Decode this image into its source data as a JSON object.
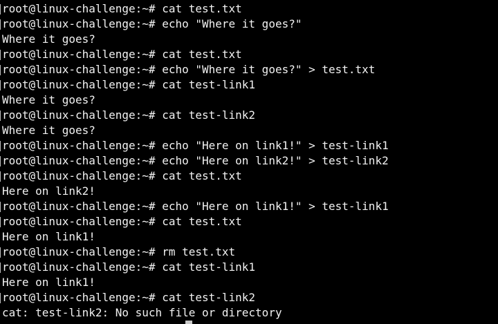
{
  "terminal": {
    "lines": [
      {
        "type": "prompt",
        "text": "root@linux-challenge:~# cat test.txt"
      },
      {
        "type": "prompt",
        "text": "root@linux-challenge:~# echo \"Where it goes?\""
      },
      {
        "type": "output",
        "text": "Where it goes?"
      },
      {
        "type": "prompt",
        "text": "root@linux-challenge:~# cat test.txt"
      },
      {
        "type": "prompt",
        "text": "root@linux-challenge:~# echo \"Where it goes?\" > test.txt"
      },
      {
        "type": "prompt",
        "text": "root@linux-challenge:~# cat test-link1"
      },
      {
        "type": "output",
        "text": "Where it goes?"
      },
      {
        "type": "prompt",
        "text": "root@linux-challenge:~# cat test-link2"
      },
      {
        "type": "output",
        "text": "Where it goes?"
      },
      {
        "type": "prompt",
        "text": "root@linux-challenge:~# echo \"Here on link1!\" > test-link1"
      },
      {
        "type": "prompt",
        "text": "root@linux-challenge:~# echo \"Here on link2!\" > test-link2"
      },
      {
        "type": "prompt",
        "text": "root@linux-challenge:~# cat test.txt"
      },
      {
        "type": "output",
        "text": "Here on link2!"
      },
      {
        "type": "prompt",
        "text": "root@linux-challenge:~# echo \"Here on link1!\" > test-link1"
      },
      {
        "type": "prompt",
        "text": "root@linux-challenge:~# cat test.txt"
      },
      {
        "type": "output",
        "text": "Here on link1!"
      },
      {
        "type": "prompt",
        "text": "root@linux-challenge:~# rm test.txt"
      },
      {
        "type": "prompt",
        "text": "root@linux-challenge:~# cat test-link1"
      },
      {
        "type": "output",
        "text": "Here on link1!"
      },
      {
        "type": "prompt",
        "text": "root@linux-challenge:~# cat test-link2"
      },
      {
        "type": "output",
        "text": "cat: test-link2: No such file or directory"
      }
    ]
  },
  "colors": {
    "background": "#000000",
    "text": "#f2f2f2",
    "cursor": "#c8c8c8"
  }
}
